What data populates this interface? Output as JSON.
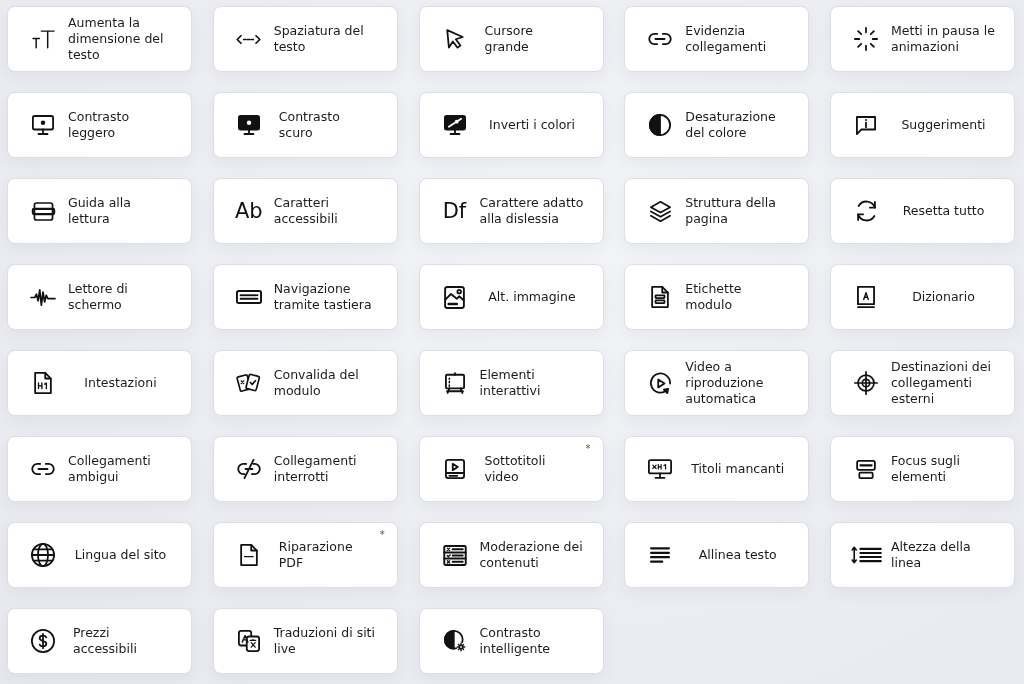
{
  "features": [
    {
      "label": "Aumenta la dimensione del testo"
    },
    {
      "label": "Spaziatura del testo"
    },
    {
      "label": "Cursore grande"
    },
    {
      "label": "Evidenzia collegamenti"
    },
    {
      "label": "Metti in pausa le animazioni"
    },
    {
      "label": "Contrasto leggero"
    },
    {
      "label": "Contrasto scuro"
    },
    {
      "label": "Inverti i colori"
    },
    {
      "label": "Desaturazione del colore"
    },
    {
      "label": "Suggerimenti"
    },
    {
      "label": "Guida alla lettura"
    },
    {
      "label": "Caratteri accessibili",
      "glyph": "Ab"
    },
    {
      "label": "Carattere adatto alla dislessia",
      "glyph": "Df"
    },
    {
      "label": "Struttura della pagina"
    },
    {
      "label": "Resetta tutto"
    },
    {
      "label": "Lettore di schermo"
    },
    {
      "label": "Navigazione tramite tastiera"
    },
    {
      "label": "Alt. immagine"
    },
    {
      "label": "Etichette modulo"
    },
    {
      "label": "Dizionario"
    },
    {
      "label": "Intestazioni"
    },
    {
      "label": "Convalida del modulo"
    },
    {
      "label": "Elementi interattivi"
    },
    {
      "label": "Video a riproduzione automatica"
    },
    {
      "label": "Destinazioni dei collegamenti esterni"
    },
    {
      "label": "Collegamenti ambigui"
    },
    {
      "label": "Collegamenti interrotti"
    },
    {
      "label": "Sottotitoli video",
      "note": "*"
    },
    {
      "label": "Titoli mancanti"
    },
    {
      "label": "Focus sugli elementi"
    },
    {
      "label": "Lingua del sito"
    },
    {
      "label": "Riparazione PDF",
      "note": "*"
    },
    {
      "label": "Moderazione dei contenuti"
    },
    {
      "label": "Allinea testo"
    },
    {
      "label": "Altezza della linea"
    },
    {
      "label": "Prezzi accessibili"
    },
    {
      "label": "Traduzioni di siti live"
    },
    {
      "label": "Contrasto intelligente"
    }
  ]
}
